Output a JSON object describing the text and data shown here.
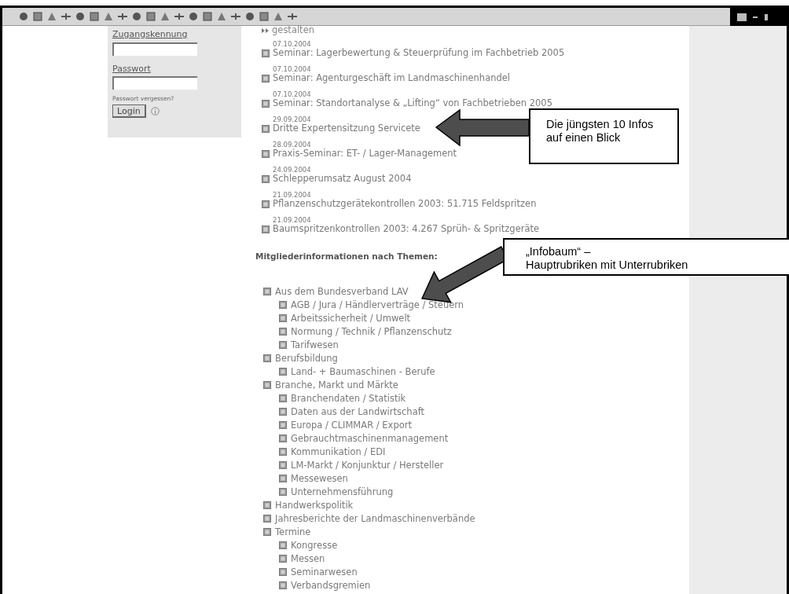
{
  "login": {
    "username_label": "Zugangskennung",
    "password_label": "Passwort",
    "forgot_link": "Passwort vergessen?",
    "login_button": "Login"
  },
  "news": {
    "cut_title": "gestalten",
    "items": [
      {
        "date": "07.10.2004",
        "title": "Seminar: Lagerbewertung & Steuerprüfung im Fachbetrieb 2005"
      },
      {
        "date": "07.10.2004",
        "title": "Seminar: Agenturgeschäft im Landmaschinenhandel"
      },
      {
        "date": "07.10.2004",
        "title": "Seminar: Standortanalyse & „Lifting“ von Fachbetrieben 2005"
      },
      {
        "date": "29.09.2004",
        "title": "Dritte Expertensitzung Servicete"
      },
      {
        "date": "28.09.2004",
        "title": "Praxis-Seminar: ET- / Lager-Management"
      },
      {
        "date": "24.09.2004",
        "title": "Schlepperumsatz August 2004"
      },
      {
        "date": "21.09.2004",
        "title": "Pflanzenschutzgerätekontrollen 2003: 51.715 Feldspritzen"
      },
      {
        "date": "21.09.2004",
        "title": "Baumspritzenkontrollen 2003: 4.267 Sprüh- & Spritzgeräte"
      }
    ]
  },
  "topics": {
    "heading": "Mitgliederinformationen nach Themen:",
    "tree": [
      {
        "label": "Aus dem Bundesverband LAV",
        "children": [
          {
            "label": "AGB / Jura / Händlerverträge / Steuern"
          },
          {
            "label": "Arbeitssicherheit / Umwelt"
          },
          {
            "label": "Normung / Technik / Pflanzenschutz"
          },
          {
            "label": "Tarifwesen"
          }
        ]
      },
      {
        "label": "Berufsbildung",
        "children": [
          {
            "label": "Land- + Baumaschinen - Berufe"
          }
        ]
      },
      {
        "label": "Branche, Markt und Märkte",
        "children": [
          {
            "label": "Branchendaten / Statistik"
          },
          {
            "label": "Daten aus der Landwirtschaft"
          },
          {
            "label": "Europa / CLIMMAR / Export"
          },
          {
            "label": "Gebrauchtmaschinenmanagement"
          },
          {
            "label": "Kommunikation / EDI"
          },
          {
            "label": "LM-Markt / Konjunktur / Hersteller"
          },
          {
            "label": "Messewesen"
          },
          {
            "label": "Unternehmensführung"
          }
        ]
      },
      {
        "label": "Handwerkspolitik"
      },
      {
        "label": "Jahresberichte der Landmaschinenverbände"
      },
      {
        "label": "Termine",
        "children": [
          {
            "label": "Kongresse"
          },
          {
            "label": "Messen"
          },
          {
            "label": "Seminarwesen"
          },
          {
            "label": "Verbandsgremien"
          }
        ]
      }
    ]
  },
  "callouts": [
    {
      "kind": "left",
      "lines": [
        "Die jüngsten 10 Infos",
        "auf einen Blick"
      ]
    },
    {
      "kind": "down_left",
      "lines": [
        "„Infobaum“ –",
        "Hauptrubriken mit Unterrubriken"
      ]
    }
  ]
}
